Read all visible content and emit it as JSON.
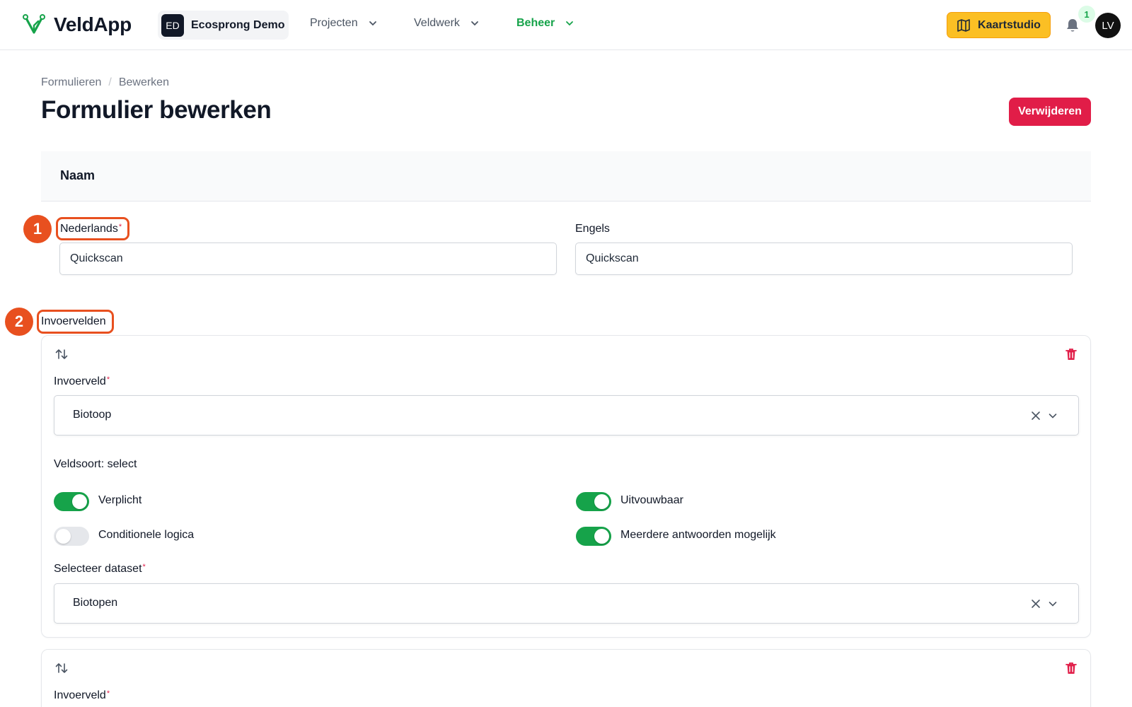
{
  "app": {
    "name": "VeldApp",
    "org_badge": "ED",
    "org_name": "Ecosprong Demo"
  },
  "nav": {
    "items": [
      {
        "label": "Projecten",
        "active": false
      },
      {
        "label": "Veldwerk",
        "active": false
      },
      {
        "label": "Beheer",
        "active": true
      }
    ],
    "map_button": "Kaartstudio",
    "notification_count": "1",
    "user_initials": "LV"
  },
  "breadcrumb": [
    "Formulieren",
    "/",
    "Bewerken"
  ],
  "page": {
    "title": "Formulier bewerken",
    "delete_button": "Verwijderen"
  },
  "name_section": {
    "title": "Naam",
    "dutch_label": "Nederlands",
    "dutch_value": "Quickscan",
    "english_label": "Engels",
    "english_value": "Quickscan",
    "required_mark": "*"
  },
  "markers": [
    "1",
    "2"
  ],
  "fields_section": {
    "title": "Invoervelden",
    "cards": [
      {
        "field_label": "Invoerveld",
        "field_value": "Biotoop",
        "type_text": "Veldsoort: select",
        "toggles": [
          {
            "label": "Verplicht",
            "on": true
          },
          {
            "label": "Uitvouwbaar",
            "on": true
          },
          {
            "label": "Conditionele logica",
            "on": false
          },
          {
            "label": "Meerdere antwoorden mogelijk",
            "on": true
          }
        ],
        "dataset_label": "Selecteer dataset",
        "dataset_value": "Biotopen"
      },
      {
        "field_label": "Invoerveld"
      }
    ]
  },
  "colors": {
    "accent_green": "#16a34a",
    "danger": "#e11d48",
    "highlight": "#e8501f",
    "map_button": "#fbbf24"
  },
  "icons": {
    "logo": "veldapp-logo-icon",
    "chevron": "chevron-down-icon",
    "map": "map-icon",
    "bell": "bell-icon",
    "sort": "sort-arrows-icon",
    "trash": "trash-icon",
    "clear": "close-icon"
  }
}
